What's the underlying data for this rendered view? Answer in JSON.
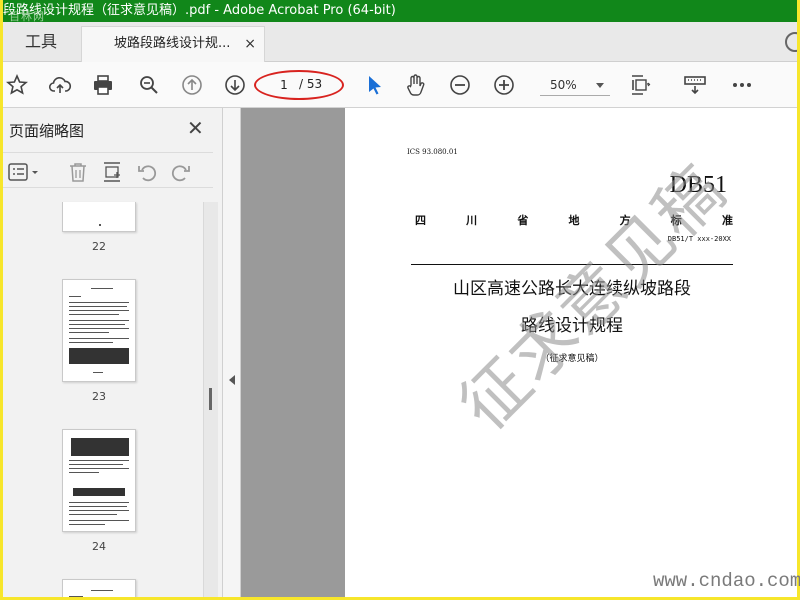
{
  "window": {
    "title": "段路线设计规程（征求意见稿）.pdf - Adobe Acrobat Pro (64-bit)",
    "logo_watermark": "百林网"
  },
  "tabs": {
    "tools_label": "工具",
    "doc_label": "坡路段路线设计规...",
    "close_glyph": "×"
  },
  "toolbar": {
    "page_current": "1",
    "page_total": "/ 53",
    "zoom": "50%",
    "icons": [
      "star-icon",
      "cloud-upload-icon",
      "print-icon",
      "zoom-search-icon",
      "page-up-icon",
      "page-down-icon",
      "select-cursor-icon",
      "hand-icon",
      "zoom-out-icon",
      "zoom-in-icon",
      "fit-page-icon",
      "read-mode-icon",
      "more-icon"
    ],
    "annotation_color": "#d8231f"
  },
  "sidebar": {
    "title": "页面缩略图",
    "close_glyph": "✕",
    "thumbnails": [
      {
        "label": "22"
      },
      {
        "label": "23"
      },
      {
        "label": "24"
      }
    ]
  },
  "document": {
    "ics": "ICS 93.080.01",
    "db": "DB51",
    "std_chars": [
      "四",
      "川",
      "省",
      "地",
      "方",
      "标",
      "准"
    ],
    "code": "DB51/T xxx-20XX",
    "title_line1": "山区高速公路长大连续纵坡路段",
    "title_line2": "路线设计规程",
    "draft_note": "（征求意见稿）",
    "watermark": "征求意见稿"
  },
  "site_watermark": "www.cndao.com",
  "colors": {
    "titlebar": "#11871a",
    "frame_border": "#f7e62b",
    "select_tool": "#1a6fd6"
  }
}
